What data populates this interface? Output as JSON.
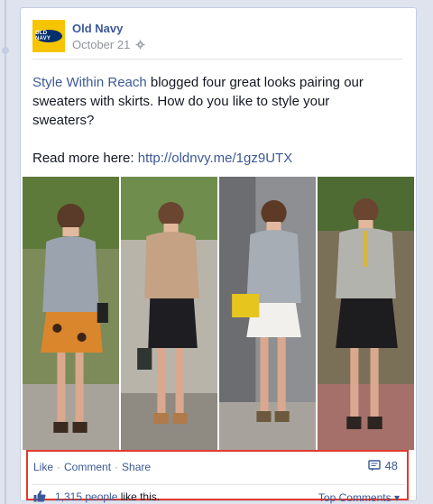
{
  "post": {
    "page_name": "Old Navy",
    "date": "October 21",
    "avatar_text": "OLD NAVY",
    "text_link": "Style Within Reach",
    "text_rest": " blogged four great looks pairing our sweaters with skirts. How do you like to style your sweaters?",
    "read_more_label": "Read more here: ",
    "read_more_url": "http://oldnvy.me/1gz9UTX"
  },
  "actions": {
    "like": "Like",
    "comment": "Comment",
    "share": "Share",
    "separator": "·",
    "comment_count": "48"
  },
  "likes": {
    "count": "1,315 people",
    "suffix": " like this.",
    "top_comments": "Top Comments",
    "caret": "▾"
  },
  "colors": {
    "link": "#3b5998",
    "highlight": "#e23a2e",
    "brand_yellow": "#f6c500",
    "brand_navy": "#002f6c"
  }
}
